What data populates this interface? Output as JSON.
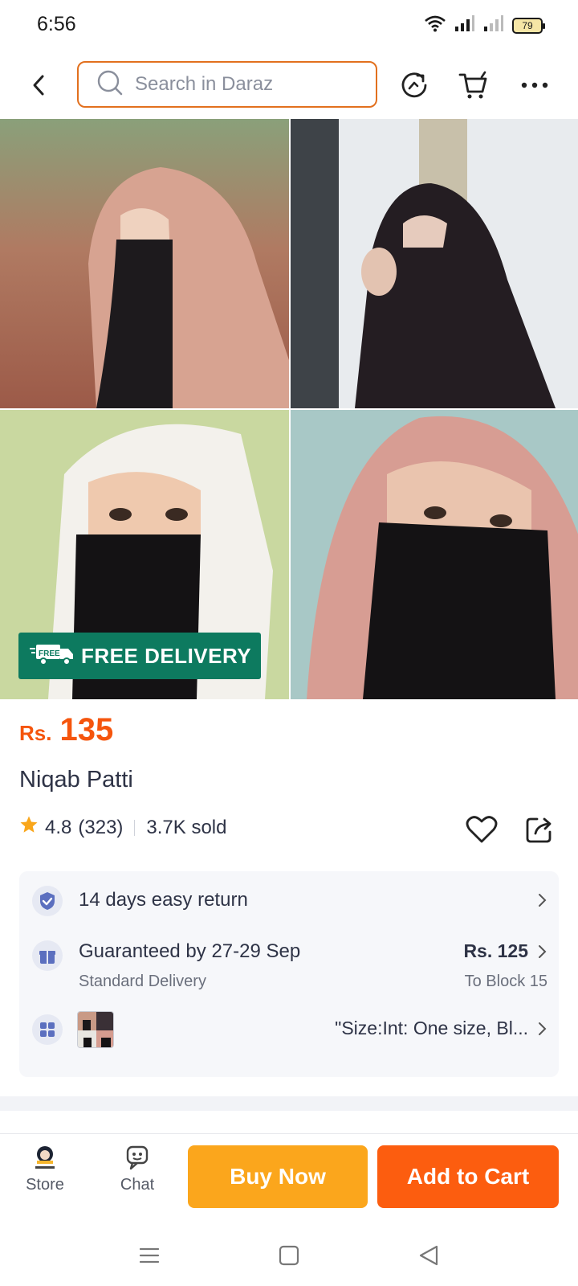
{
  "status_bar": {
    "time": "6:56",
    "battery": "79"
  },
  "header": {
    "search_placeholder": "Search in Daraz"
  },
  "gallery": {
    "badge_text": "FREE DELIVERY",
    "badge_truck_label": "FREE"
  },
  "product": {
    "currency": "Rs.",
    "price": "135",
    "title": "Niqab Patti",
    "rating": "4.8",
    "reviews": "(323)",
    "sold": "3.7K sold"
  },
  "services": {
    "return": "14 days easy return",
    "delivery_title": "Guaranteed by 27-29 Sep",
    "delivery_sub": "Standard Delivery",
    "delivery_fee": "Rs. 125",
    "delivery_to": "To Block 15",
    "variant": "\"Size:Int: One size, Bl..."
  },
  "bottom_bar": {
    "store": "Store",
    "chat": "Chat",
    "buy_now": "Buy Now",
    "add_to_cart": "Add to Cart"
  },
  "colors": {
    "accent": "#fc5d0f",
    "price": "#f5550d",
    "buy_now": "#fba61c",
    "free_delivery": "#0d7a5f",
    "search_border": "#e2701e"
  }
}
